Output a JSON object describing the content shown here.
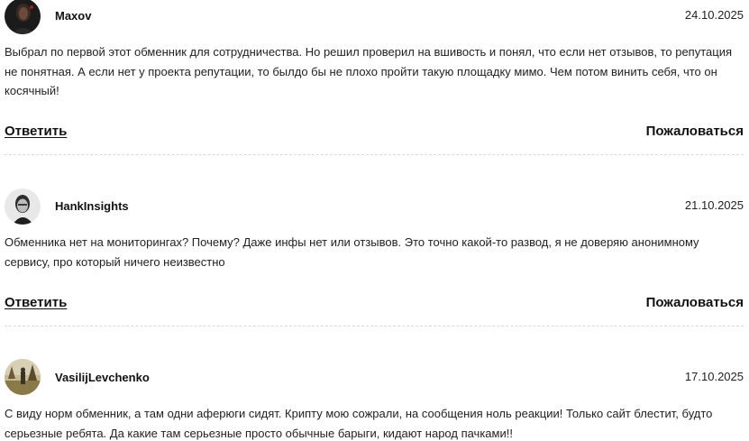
{
  "comments": [
    {
      "author": "Maxov",
      "date": "24.10.2025",
      "text": "Выбрал по первой этот обменник для сотрудничества. Но решил проверил на вшивость и понял, что если нет отзывов, то репутация не понятная. А если нет у проекта репутации, то былдо бы не плохо пройти такую площадку мимо. Чем потом винить себя, что он косячный!",
      "reply_label": "Ответить",
      "report_label": "Пожаловаться",
      "avatar": "dark-portrait-avatar"
    },
    {
      "author": "HankInsights",
      "date": "21.10.2025",
      "text": "Обменника нет на мониторингах? Почему? Даже инфы нет или отзывов. Это точно какой-то развод, я не доверяю анонимному сервису, про который ничего неизвестно",
      "reply_label": "Ответить",
      "report_label": "Пожаловаться",
      "avatar": "bw-portrait-avatar"
    },
    {
      "author": "VasilijLevchenko",
      "date": "17.10.2025",
      "text": "С виду норм обменник, а там одни аферюги сидят. Крипту мою сожрали, на сообщения ноль реакции! Только сайт блестит, будто серьезные ребята. Да какие там серьезные просто обычные барыги, кидают народ пачками!!",
      "avatar": "landscape-avatar"
    }
  ],
  "colors": {
    "text": "#222222",
    "divider": "#d9d9d9",
    "background": "#ffffff"
  }
}
